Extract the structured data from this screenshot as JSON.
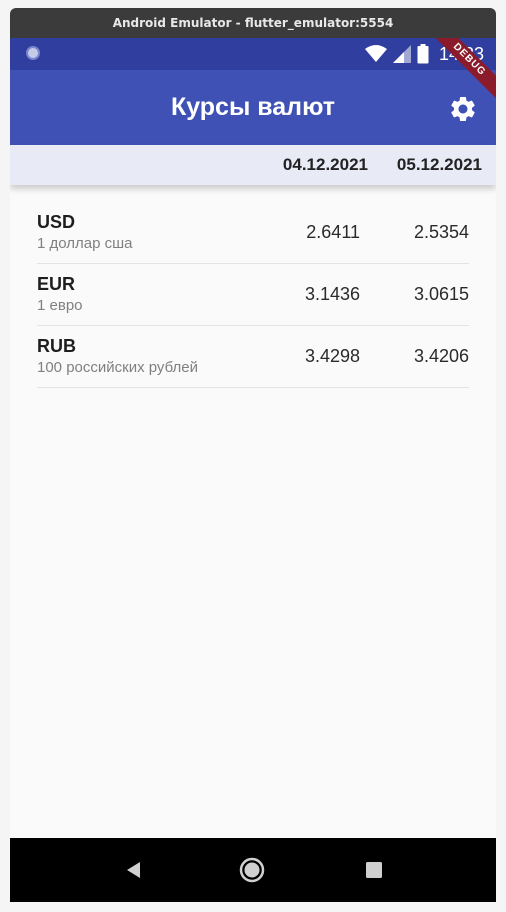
{
  "window": {
    "title": "Android Emulator - flutter_emulator:5554"
  },
  "status_bar": {
    "time": "14:33",
    "icons": [
      "notification-dot-icon",
      "wifi-icon",
      "signal-icon",
      "battery-icon"
    ]
  },
  "debug_banner": "DEBUG",
  "app_bar": {
    "title": "Курсы валют",
    "action_icon": "settings-gear-icon"
  },
  "date_header": {
    "dates": [
      "04.12.2021",
      "05.12.2021"
    ]
  },
  "rates": [
    {
      "code": "USD",
      "name": "1 доллар сша",
      "values": [
        "2.6411",
        "2.5354"
      ]
    },
    {
      "code": "EUR",
      "name": "1 евро",
      "values": [
        "3.1436",
        "3.0615"
      ]
    },
    {
      "code": "RUB",
      "name": "100 российских рублей",
      "values": [
        "3.4298",
        "3.4206"
      ]
    }
  ],
  "nav_bar": {
    "buttons": [
      "back-icon",
      "home-icon",
      "recent-apps-icon"
    ]
  },
  "colors": {
    "primary": "#3f51b5",
    "primary_dark": "#303f9f",
    "header_bg": "#e8eaf6",
    "debug_banner": "#8b1a2b"
  }
}
